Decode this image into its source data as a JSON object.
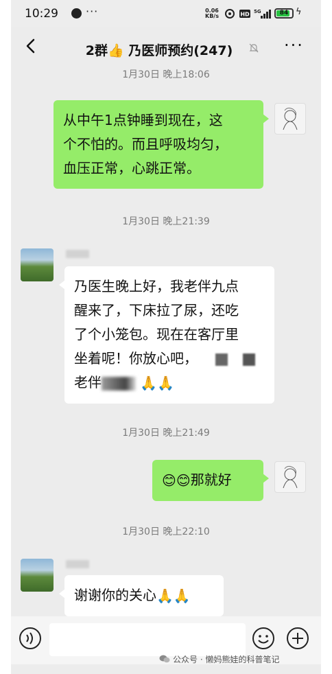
{
  "status_bar": {
    "time": "10:29",
    "more": "···",
    "net_speed_value": "0.06",
    "net_speed_unit": "KB/s",
    "battery": "84",
    "icons": [
      "notification-dot-icon",
      "hotspot-icon",
      "hd-icon",
      "5g-signal-icon",
      "battery-icon",
      "charging-icon"
    ]
  },
  "header": {
    "title": "2群👍 乃医师预约(247)",
    "menu": "···",
    "icons": [
      "back-arrow-icon",
      "mute-bell-icon"
    ]
  },
  "messages": [
    {
      "type": "timestamp",
      "text": "1月30日 晚上18:06"
    },
    {
      "type": "outgoing",
      "lines": [
        "从中午1点钟睡到现在，这",
        "个不怕的。而且呼吸均匀，",
        "血压正常，心跳正常。"
      ]
    },
    {
      "type": "timestamp",
      "text": "1月30日 晚上21:39"
    },
    {
      "type": "incoming",
      "lines": [
        "乃医生晚上好，我老伴九点",
        "醒来了，下床拉了尿，还吃",
        "了个小笼包。现在在客厅里",
        "坐着呢！你放心吧，",
        "老伴"
      ],
      "emoji": "🙏🙏"
    },
    {
      "type": "timestamp",
      "text": "1月30日 晚上21:49"
    },
    {
      "type": "outgoing",
      "emoji": "😊😊",
      "text": "那就好"
    },
    {
      "type": "timestamp",
      "text": "1月30日 晚上22:10"
    },
    {
      "type": "incoming",
      "text": "谢谢你的关心",
      "emoji": "🙏🙏"
    }
  ],
  "input_bar": {
    "placeholder": "",
    "icons": [
      "voice-icon",
      "emoji-icon",
      "plus-icon"
    ]
  },
  "watermark": {
    "text": "公众号 · 懒妈熊娃的科普笔记"
  },
  "colors": {
    "background": "#ececec",
    "outgoing_bubble": "#95ec69",
    "incoming_bubble": "#ffffff",
    "timestamp_text": "#7a7a7a",
    "battery_fill": "#27c241"
  }
}
